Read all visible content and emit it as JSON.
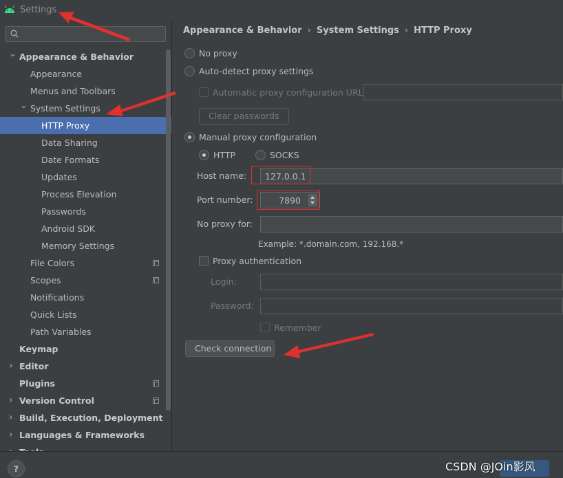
{
  "window": {
    "title": "Settings"
  },
  "search": {
    "placeholder": "",
    "value": ""
  },
  "tree": [
    {
      "label": "Appearance & Behavior",
      "level": 0,
      "arrow": "down",
      "bold": true
    },
    {
      "label": "Appearance",
      "level": 1
    },
    {
      "label": "Menus and Toolbars",
      "level": 1
    },
    {
      "label": "System Settings",
      "level": 1,
      "arrow": "down"
    },
    {
      "label": "HTTP Proxy",
      "level": 2,
      "selected": true
    },
    {
      "label": "Data Sharing",
      "level": 2
    },
    {
      "label": "Date Formats",
      "level": 2
    },
    {
      "label": "Updates",
      "level": 2
    },
    {
      "label": "Process Elevation",
      "level": 2
    },
    {
      "label": "Passwords",
      "level": 2
    },
    {
      "label": "Android SDK",
      "level": 2
    },
    {
      "label": "Memory Settings",
      "level": 2
    },
    {
      "label": "File Colors",
      "level": 1,
      "copy": true
    },
    {
      "label": "Scopes",
      "level": 1,
      "copy": true
    },
    {
      "label": "Notifications",
      "level": 1
    },
    {
      "label": "Quick Lists",
      "level": 1
    },
    {
      "label": "Path Variables",
      "level": 1
    },
    {
      "label": "Keymap",
      "level": 0,
      "bold": true
    },
    {
      "label": "Editor",
      "level": 0,
      "arrow": "right",
      "bold": true
    },
    {
      "label": "Plugins",
      "level": 0,
      "bold": true,
      "copy": true
    },
    {
      "label": "Version Control",
      "level": 0,
      "arrow": "right",
      "bold": true,
      "copy": true
    },
    {
      "label": "Build, Execution, Deployment",
      "level": 0,
      "arrow": "right",
      "bold": true
    },
    {
      "label": "Languages & Frameworks",
      "level": 0,
      "arrow": "right",
      "bold": true
    },
    {
      "label": "Tools",
      "level": 0,
      "arrow": "right",
      "bold": true
    }
  ],
  "breadcrumb": {
    "part1": "Appearance & Behavior",
    "part2": "System Settings",
    "part3": "HTTP Proxy"
  },
  "proxy": {
    "no_proxy": "No proxy",
    "auto_detect": "Auto-detect proxy settings",
    "auto_config_url": "Automatic proxy configuration URL:",
    "auto_config_value": "",
    "clear_passwords": "Clear passwords",
    "manual": "Manual proxy configuration",
    "http": "HTTP",
    "socks": "SOCKS",
    "host_label": "Host name:",
    "host_value": "127.0.0.1",
    "port_label": "Port number:",
    "port_value": "7890",
    "no_proxy_for_label": "No proxy for:",
    "no_proxy_for_value": "",
    "example": "Example: *.domain.com, 192.168.*",
    "proxy_auth": "Proxy authentication",
    "login_label": "Login:",
    "password_label": "Password:",
    "remember": "Remember",
    "check_connection": "Check connection"
  },
  "bottom": {
    "help": "?",
    "watermark": "CSDN @JOin影风"
  },
  "colors": {
    "selection": "#4b6eaf",
    "annotation": "#e0312f",
    "background": "#3c3f41"
  }
}
